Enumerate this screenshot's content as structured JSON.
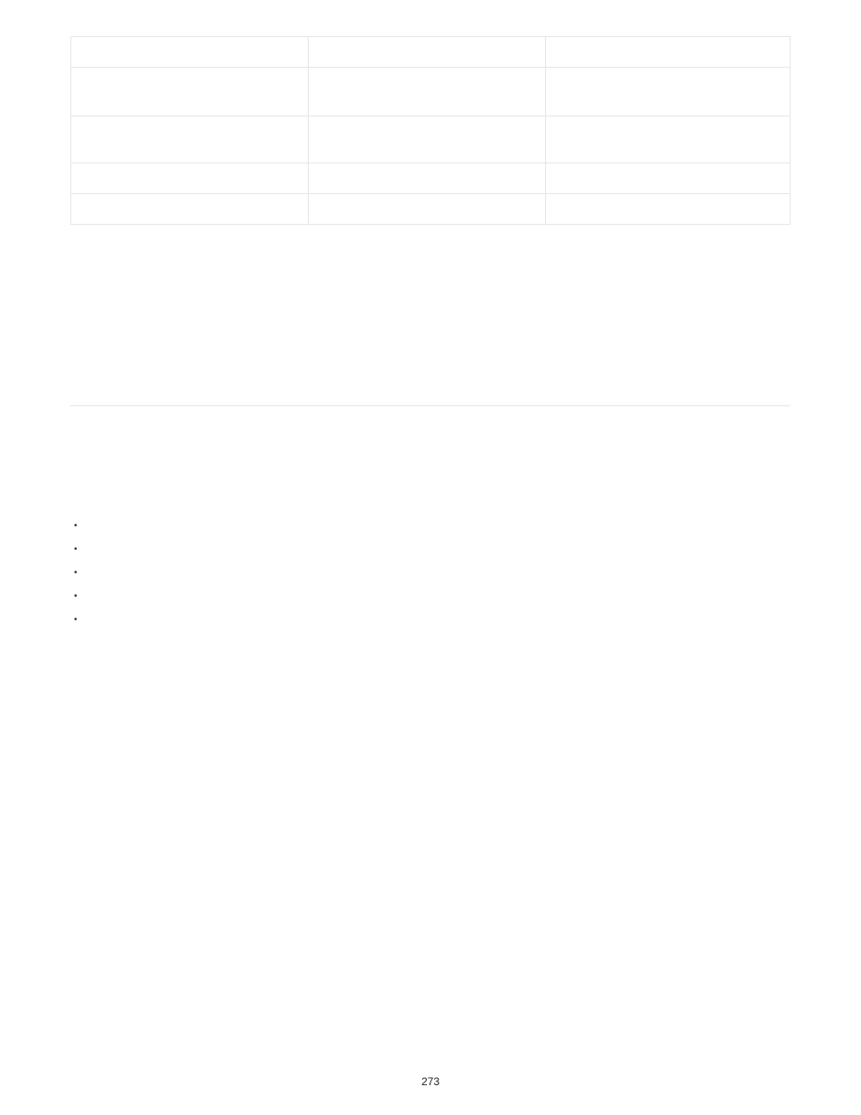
{
  "table": {
    "columns": 3,
    "rows": [
      {
        "cells": [
          "",
          "",
          ""
        ],
        "class": ""
      },
      {
        "cells": [
          "",
          "",
          ""
        ],
        "class": "row-tall"
      },
      {
        "cells": [
          "",
          "",
          ""
        ],
        "class": "row-med"
      },
      {
        "cells": [
          "",
          "",
          ""
        ],
        "class": ""
      },
      {
        "cells": [
          "",
          "",
          ""
        ],
        "class": ""
      }
    ]
  },
  "bullets": [
    "",
    "",
    "",
    "",
    ""
  ],
  "page_number": "273"
}
